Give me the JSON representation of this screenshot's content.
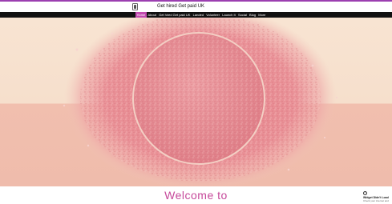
{
  "header": {
    "logo_icon": "crest-logo-icon",
    "site_title": "Get hired Get paid UK"
  },
  "nav": {
    "items": [
      {
        "label": "Home",
        "active": true
      },
      {
        "label": "About",
        "active": false
      },
      {
        "label": "Get hired Get paid UK",
        "active": false
      },
      {
        "label": "Landed",
        "active": false
      },
      {
        "label": "Volunteer",
        "active": false
      },
      {
        "label": "Launch It",
        "active": false
      },
      {
        "label": "Social",
        "active": false
      },
      {
        "label": "Blog",
        "active": false
      },
      {
        "label": "More",
        "active": false
      }
    ]
  },
  "hero": {
    "image": "pink crushed powder with round disc",
    "colors": {
      "top_band": "#f8e4d2",
      "bottom_band": "#f1bfae",
      "powder": "#e88990"
    }
  },
  "main": {
    "welcome_text": "Welcome to"
  },
  "widget": {
    "icon": "warning-icon",
    "title": "Widget Didn't Load",
    "subtitle": "Check your internet and"
  },
  "colors": {
    "accent": "#c24bb0",
    "top_bar": "#9b3fb0",
    "nav_bg": "#111111",
    "welcome": "#c6489a"
  }
}
